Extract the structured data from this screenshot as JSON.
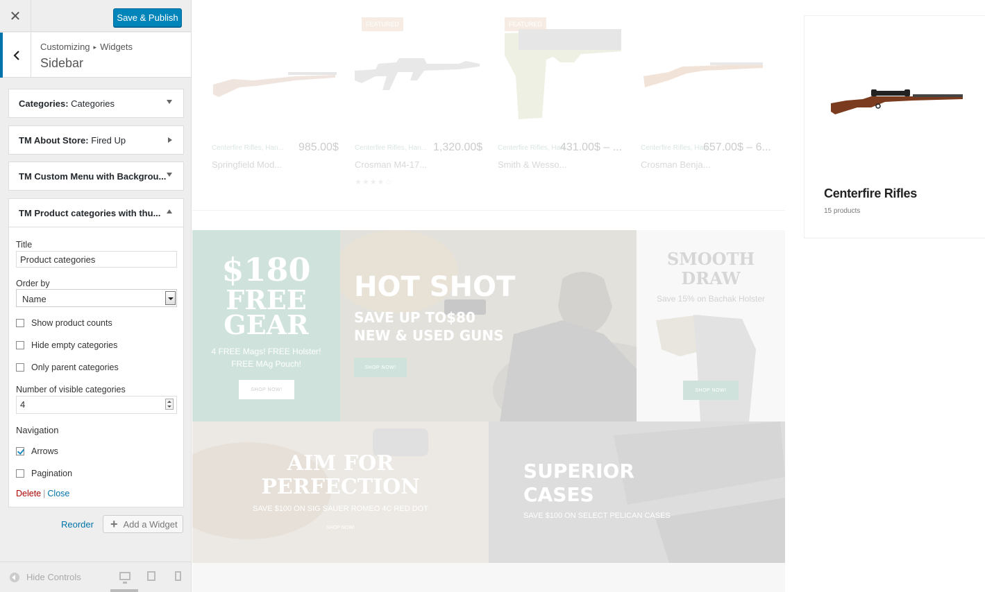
{
  "header": {
    "close_icon": "close-icon",
    "publish_label": "Save & Publish"
  },
  "breadcrumb": {
    "parent": "Customizing",
    "child": "Widgets",
    "title": "Sidebar"
  },
  "widgets": [
    {
      "type": "Categories:",
      "title": "Categories",
      "state": "collapsed"
    },
    {
      "type": "TM About Store:",
      "title": "Fired Up",
      "state": "collapsed"
    },
    {
      "type": "TM Custom Menu with Backgrou...",
      "title": "",
      "state": "collapsed"
    },
    {
      "type": "TM Product categories with thu...",
      "title": "",
      "state": "expanded"
    }
  ],
  "form": {
    "title_label": "Title",
    "title_value": "Product categories",
    "order_label": "Order by",
    "order_value": "Name",
    "show_counts_label": "Show product counts",
    "show_counts_checked": false,
    "hide_empty_label": "Hide empty categories",
    "hide_empty_checked": false,
    "only_parent_label": "Only parent categories",
    "only_parent_checked": false,
    "visible_label": "Number of visible categories",
    "visible_value": "4",
    "navigation_label": "Navigation",
    "arrows_label": "Arrows",
    "arrows_checked": true,
    "pagination_label": "Pagination",
    "pagination_checked": false,
    "delete_label": "Delete",
    "separator": "|",
    "close_label": "Close"
  },
  "actions": {
    "reorder_label": "Reorder",
    "add_widget_label": "Add a Widget"
  },
  "footer": {
    "hide_controls_label": "Hide Controls"
  },
  "products": [
    {
      "badge": "",
      "category": "Centerfire Rifles, Han...",
      "price": "985.00$",
      "name": "Springfield Mod..."
    },
    {
      "badge": "FEATURED",
      "category": "Centerfire Rifles, Han...",
      "price": "1,320.00$",
      "name": "Crosman M4-17...",
      "stars": "★★★★☆"
    },
    {
      "badge": "FEATURED",
      "category": "Centerfire Rifles, Han...",
      "price": "431.00$ – ...",
      "name": "Smith & Wesso..."
    },
    {
      "badge": "",
      "category": "Centerfire Rifles, Han...",
      "price": "657.00$ – 6...",
      "name": "Crosman Benja..."
    }
  ],
  "category_card": {
    "title": "Centerfire Rifles",
    "count": "15 products"
  },
  "banners": {
    "b1_line1": "$180",
    "b1_line2": "FREE",
    "b1_line3": "GEAR",
    "b1_sub1": "4 FREE Mags! FREE Holster!",
    "b1_sub2": "FREE MAg Pouch!",
    "b1_btn": "SHOP NOW!",
    "b2_title": "HOT SHOT",
    "b2_sub1": "SAVE UP TO$80",
    "b2_sub2": "NEW & USED GUNS",
    "b2_btn": "SHOP NOW!",
    "b3_title1": "SMOOTH",
    "b3_title2": "DRAW",
    "b3_sub": "Save 15% on Bachak Holster",
    "b3_btn": "SHOP NOW!",
    "b4_title1": "AIM FOR",
    "b4_title2": "PERFECTION",
    "b4_sub": "SAVE $100 ON SIG SAUER ROMEO 4C RED DOT",
    "b4_btn": "SHOP NOW!",
    "b5_title1": "SUPERIOR",
    "b5_title2": "CASES",
    "b5_sub": "SAVE $100 ON SELECT PELICAN CASES"
  },
  "colors": {
    "primary": "#0085ba",
    "link": "#0073aa",
    "delete": "#a00000",
    "mint": "#cfe3dc"
  }
}
